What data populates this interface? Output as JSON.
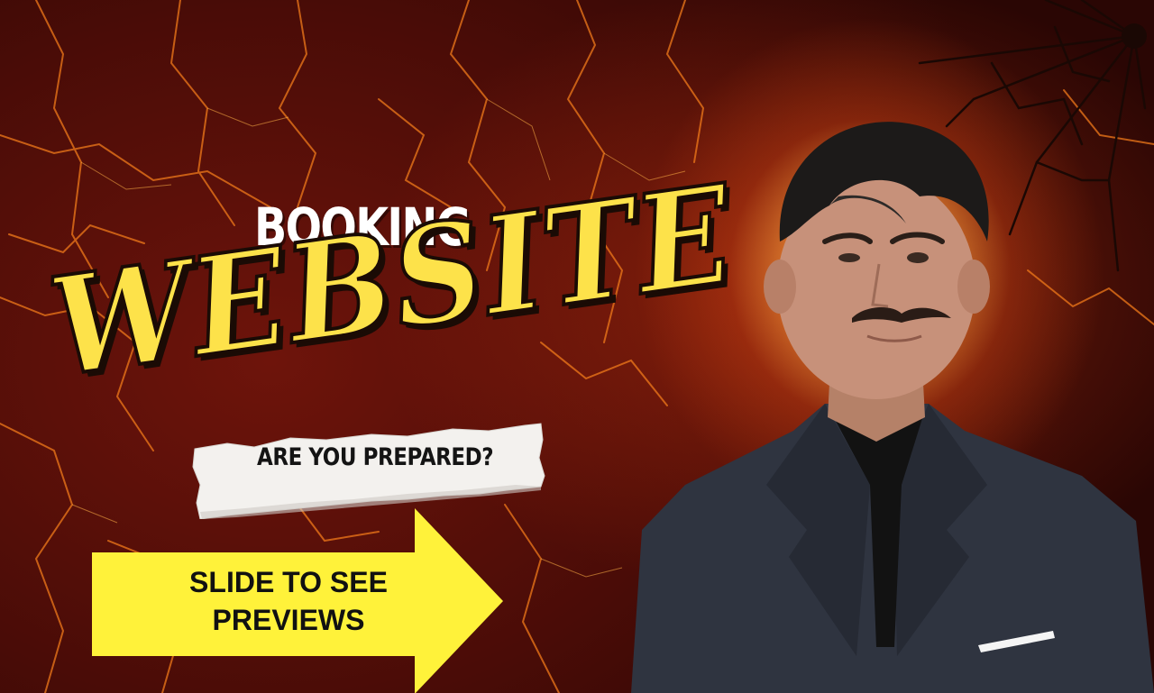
{
  "headline": {
    "top_word": "BOOKING",
    "main_word": "WEBSITE"
  },
  "tagline": "ARE YOU PREPARED?",
  "cta": {
    "line1": "SLIDE TO SEE",
    "line2": "PREVIEWS"
  },
  "colors": {
    "background_dark": "#4a0c07",
    "crack_glow": "#f07a1a",
    "headline_yellow": "#fde24a",
    "arrow_yellow": "#fff23a",
    "glow": "#ffe7a8"
  },
  "imagery": {
    "portrait": "man-in-dark-blazer",
    "texture": "cracked-lava-texture",
    "decoration": "shattered-glass-cracks"
  }
}
